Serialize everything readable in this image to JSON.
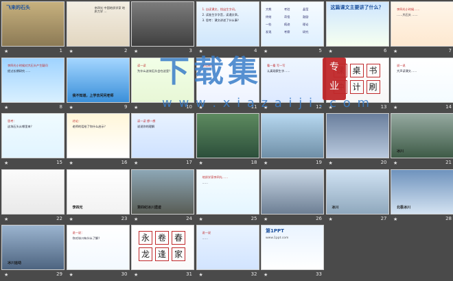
{
  "slides": [
    {
      "num": "1",
      "title": "飞来的石头"
    },
    {
      "num": "2",
      "text": "李四光 中国地质学家 地质力学 …"
    },
    {
      "num": "3"
    },
    {
      "num": "4",
      "lines": [
        "1. 自读课文，找出生字词。",
        "2. 读准生字字音，读通文章。",
        "3. 思考：课文讲述了什么事？"
      ]
    },
    {
      "num": "5",
      "words": [
        "大熊",
        "考验",
        "晶莹",
        "终结",
        "奇怪",
        "鼓励",
        "一些",
        "痕迹",
        "理论",
        "发现",
        "考察",
        "研究"
      ]
    },
    {
      "num": "6",
      "title": "这篇课文主要讲了什么？"
    },
    {
      "num": "7",
      "lines": [
        "李四光小时候……",
        "……大石头 ……"
      ]
    },
    {
      "num": "8",
      "lines": [
        "李四光小时候对大石头产生疑问",
        "经过长期研究……"
      ]
    },
    {
      "num": "9",
      "caption": "我不知道，上学去问问老师"
    },
    {
      "num": "10",
      "lines": [
        "读一读",
        "为什么这块石头会在这里？"
      ]
    },
    {
      "num": "11",
      "lines": [
        "说话练习",
        "……"
      ]
    },
    {
      "num": "12",
      "lines": [
        "看一看 写一写",
        "认真观察生字……"
      ]
    },
    {
      "num": "13",
      "chars": [
        "课",
        "桌",
        "书",
        "冲",
        "计",
        "刷"
      ]
    },
    {
      "num": "14",
      "lines": [
        "说一说",
        "大声读课文……"
      ]
    },
    {
      "num": "15",
      "lines": [
        "思考：",
        "这块石头从哪里来？"
      ]
    },
    {
      "num": "16",
      "lines": [
        "讨论：",
        "老师的话给了你什么启示？"
      ]
    },
    {
      "num": "17",
      "lines": [
        "读一读 想一想",
        "说说你的理解"
      ]
    },
    {
      "num": "18"
    },
    {
      "num": "19"
    },
    {
      "num": "20"
    },
    {
      "num": "21",
      "caption": "冰川"
    },
    {
      "num": "22"
    },
    {
      "num": "23",
      "caption": "李四光"
    },
    {
      "num": "24",
      "caption": "第四纪冰川遗迹"
    },
    {
      "num": "25",
      "lines": [
        "地质学家李四光……",
        "……"
      ]
    },
    {
      "num": "26"
    },
    {
      "num": "27",
      "caption": "冰川"
    },
    {
      "num": "28",
      "caption": "北极冰川"
    },
    {
      "num": "29",
      "caption": "冰川运动"
    },
    {
      "num": "30",
      "lines": [
        "说一说：",
        "你对冰川有什么了解？"
      ]
    },
    {
      "num": "31",
      "chars": [
        "永",
        "卷",
        "春",
        "龙",
        "逢",
        "家"
      ]
    },
    {
      "num": "32",
      "lines": [
        "说一说",
        "……"
      ]
    },
    {
      "num": "33",
      "title": "第1PPT",
      "sub": "www.1ppt.com"
    }
  ],
  "watermark": {
    "main": "下载集",
    "sub": "w w w . x i a z a i j i . c o m",
    "seal": [
      "专",
      "业"
    ]
  },
  "colors": {
    "background": "#4a4a4a",
    "accent": "#f0b400",
    "seal": "#c0282a",
    "watermark": "#3a7ec9"
  },
  "star_icon": "★"
}
